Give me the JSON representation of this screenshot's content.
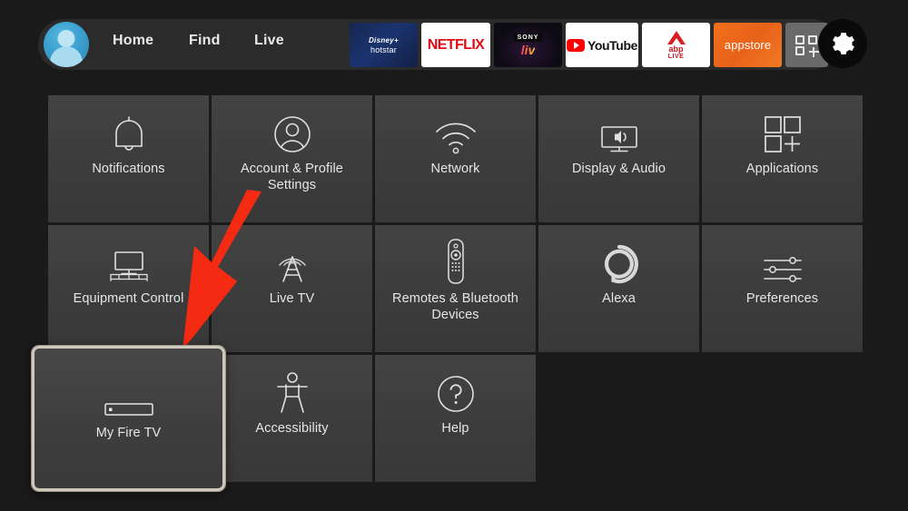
{
  "header": {
    "avatar": {
      "icon": "user-avatar-icon"
    },
    "nav": [
      {
        "id": "home",
        "label": "Home"
      },
      {
        "id": "find",
        "label": "Find"
      },
      {
        "id": "live",
        "label": "Live"
      }
    ],
    "apps": [
      {
        "id": "hotstar",
        "name": "disney-plus-hotstar-app",
        "line1": "Disney+",
        "line2": "hotstar"
      },
      {
        "id": "netflix",
        "name": "netflix-app",
        "label": "NETFLIX"
      },
      {
        "id": "sonyliv",
        "name": "sony-liv-app",
        "line1": "SONY",
        "line2": "liv"
      },
      {
        "id": "youtube",
        "name": "youtube-app",
        "label": "YouTube"
      },
      {
        "id": "abplive",
        "name": "abp-live-app",
        "line1": "abp",
        "line2": "LIVE"
      },
      {
        "id": "appstore",
        "name": "appstore-app",
        "label": "appstore"
      },
      {
        "id": "gridapps",
        "name": "all-apps-button",
        "label": ""
      }
    ],
    "settings_button": {
      "icon": "gear-icon",
      "selected": true
    }
  },
  "settings_grid": {
    "rows": [
      [
        {
          "id": "notifications",
          "label": "Notifications",
          "icon": "bell-icon"
        },
        {
          "id": "account-profile",
          "label": "Account & Profile Settings",
          "icon": "person-circle-icon"
        },
        {
          "id": "network",
          "label": "Network",
          "icon": "wifi-icon"
        },
        {
          "id": "display-audio",
          "label": "Display & Audio",
          "icon": "tv-speaker-icon"
        },
        {
          "id": "applications",
          "label": "Applications",
          "icon": "apps-grid-plus-icon"
        }
      ],
      [
        {
          "id": "equipment-control",
          "label": "Equipment Control",
          "icon": "tv-stand-icon"
        },
        {
          "id": "live-tv",
          "label": "Live TV",
          "icon": "antenna-tower-icon"
        },
        {
          "id": "remotes-bluetooth",
          "label": "Remotes & Bluetooth Devices",
          "icon": "remote-control-icon"
        },
        {
          "id": "alexa",
          "label": "Alexa",
          "icon": "alexa-ring-icon"
        },
        {
          "id": "preferences",
          "label": "Preferences",
          "icon": "sliders-icon"
        }
      ],
      [
        {
          "id": "my-fire-tv",
          "label": "My Fire TV",
          "icon": "fire-tv-stick-icon",
          "selected": true
        },
        {
          "id": "accessibility",
          "label": "Accessibility",
          "icon": "accessibility-person-icon"
        },
        {
          "id": "help",
          "label": "Help",
          "icon": "question-circle-icon"
        }
      ]
    ]
  },
  "annotation": {
    "arrow": {
      "name": "red-pointer-arrow",
      "color": "#f42a12",
      "points_to": "my-fire-tv"
    }
  },
  "colors": {
    "page_background": "#1a1a1a",
    "tile_background": "#3e3e3e",
    "selected_border": "#cfc8bb",
    "accent_red": "#f42a12",
    "avatar_blue": "#3ba0cf"
  }
}
